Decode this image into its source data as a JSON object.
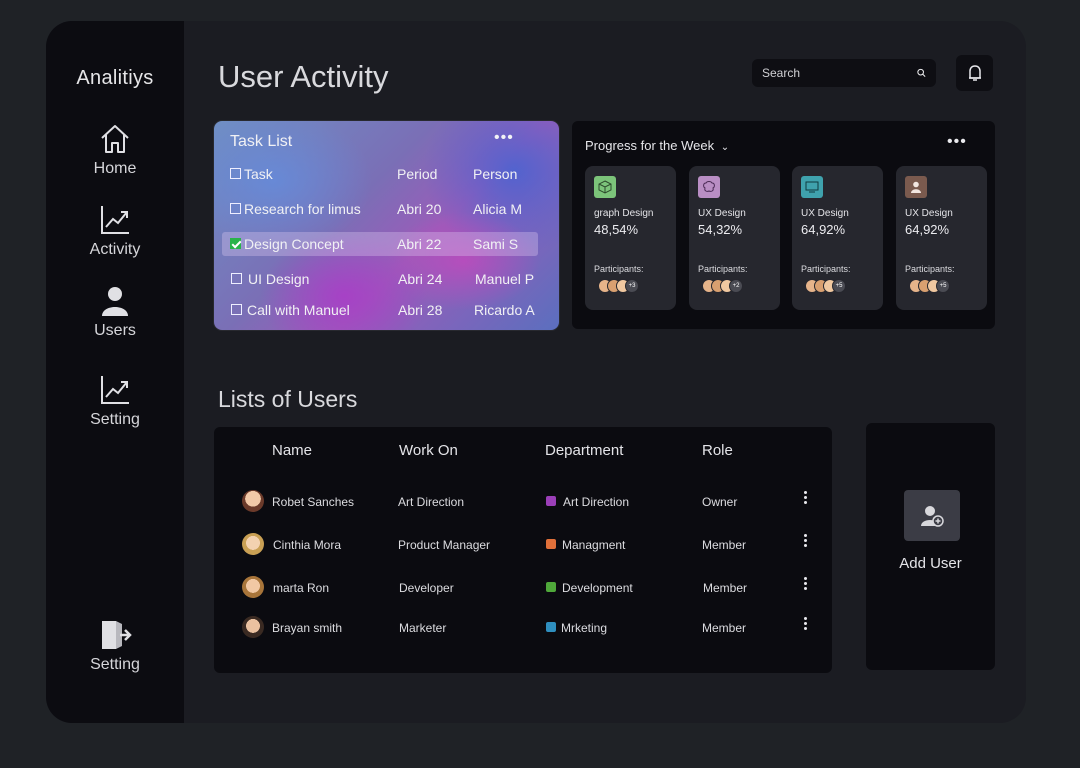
{
  "sidebar": {
    "brand": "Analitiys",
    "items": [
      {
        "label": "Home",
        "icon": "home-icon"
      },
      {
        "label": "Activity",
        "icon": "chart-icon"
      },
      {
        "label": "Users",
        "icon": "user-icon"
      },
      {
        "label": "Setting",
        "icon": "chart-icon"
      }
    ],
    "bottom": {
      "label": "Setting",
      "icon": "logout-icon"
    }
  },
  "header": {
    "title": "User Activity",
    "search_placeholder": "Search"
  },
  "task_list": {
    "title": "Task List",
    "headers": {
      "task": "Task",
      "period": "Period",
      "person": "Person"
    },
    "rows": [
      {
        "task": "Research for limus",
        "period": "Abri 20",
        "person": "Alicia M",
        "checked": false
      },
      {
        "task": "Design Concept",
        "period": "Abri 22",
        "person": "Sami S",
        "checked": true
      },
      {
        "task": "UI Design",
        "period": "Abri 24",
        "person": "Manuel P",
        "checked": false
      },
      {
        "task": "Call with Manuel",
        "period": "Abri 28",
        "person": "Ricardo A",
        "checked": false
      }
    ]
  },
  "progress": {
    "title": "Progress for the Week",
    "participants_label": "Participants:",
    "cards": [
      {
        "name": "graph Design",
        "percent": "48,54%",
        "icon": "cube-icon",
        "color": "#7cc47a",
        "extra": "+3"
      },
      {
        "name": "UX Design",
        "percent": "54,32%",
        "icon": "brain-icon",
        "color": "#b98ec4",
        "extra": "+2"
      },
      {
        "name": "UX Design",
        "percent": "64,92%",
        "icon": "monitor-icon",
        "color": "#3fa2ad",
        "extra": "+5"
      },
      {
        "name": "UX Design",
        "percent": "64,92%",
        "icon": "person-icon",
        "color": "#7a5a4e",
        "extra": "+5"
      }
    ]
  },
  "users": {
    "title": "Lists of Users",
    "headers": {
      "name": "Name",
      "work": "Work On",
      "department": "Department",
      "role": "Role"
    },
    "rows": [
      {
        "name": "Robet Sanches",
        "work": "Art Direction",
        "department": "Art Direction",
        "dept_color": "#9b3fb8",
        "role": "Owner"
      },
      {
        "name": "Cinthia Mora",
        "work": "Product Manager",
        "department": "Managment",
        "dept_color": "#e0703a",
        "role": "Member"
      },
      {
        "name": "marta Ron",
        "work": "Developer",
        "department": "Development",
        "dept_color": "#4fa83a",
        "role": "Member"
      },
      {
        "name": "Brayan smith",
        "work": "Marketer",
        "department": "Mrketing",
        "dept_color": "#2f8fbf",
        "role": "Member"
      }
    ],
    "add_label": "Add User"
  }
}
